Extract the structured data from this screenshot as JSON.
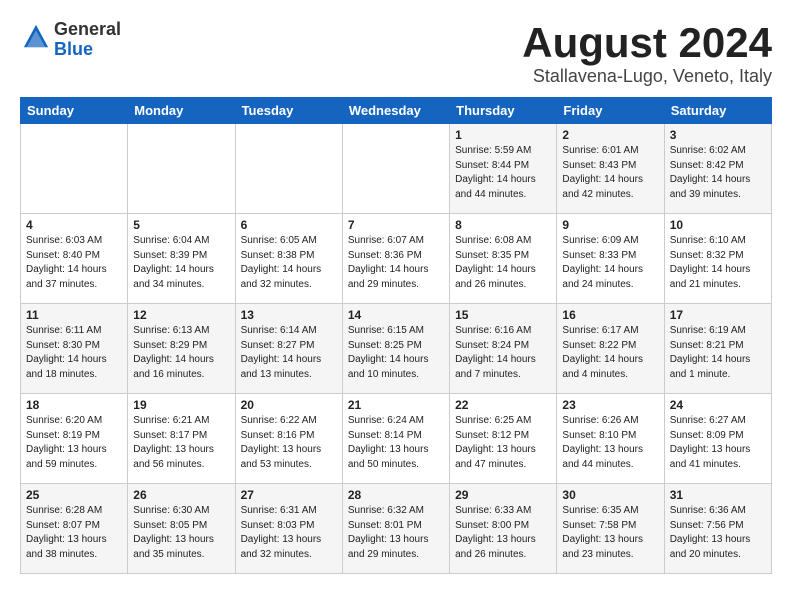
{
  "logo": {
    "general": "General",
    "blue": "Blue"
  },
  "header": {
    "month_year": "August 2024",
    "location": "Stallavena-Lugo, Veneto, Italy"
  },
  "days_of_week": [
    "Sunday",
    "Monday",
    "Tuesday",
    "Wednesday",
    "Thursday",
    "Friday",
    "Saturday"
  ],
  "weeks": [
    [
      {
        "day": "",
        "info": ""
      },
      {
        "day": "",
        "info": ""
      },
      {
        "day": "",
        "info": ""
      },
      {
        "day": "",
        "info": ""
      },
      {
        "day": "1",
        "info": "Sunrise: 5:59 AM\nSunset: 8:44 PM\nDaylight: 14 hours\nand 44 minutes."
      },
      {
        "day": "2",
        "info": "Sunrise: 6:01 AM\nSunset: 8:43 PM\nDaylight: 14 hours\nand 42 minutes."
      },
      {
        "day": "3",
        "info": "Sunrise: 6:02 AM\nSunset: 8:42 PM\nDaylight: 14 hours\nand 39 minutes."
      }
    ],
    [
      {
        "day": "4",
        "info": "Sunrise: 6:03 AM\nSunset: 8:40 PM\nDaylight: 14 hours\nand 37 minutes."
      },
      {
        "day": "5",
        "info": "Sunrise: 6:04 AM\nSunset: 8:39 PM\nDaylight: 14 hours\nand 34 minutes."
      },
      {
        "day": "6",
        "info": "Sunrise: 6:05 AM\nSunset: 8:38 PM\nDaylight: 14 hours\nand 32 minutes."
      },
      {
        "day": "7",
        "info": "Sunrise: 6:07 AM\nSunset: 8:36 PM\nDaylight: 14 hours\nand 29 minutes."
      },
      {
        "day": "8",
        "info": "Sunrise: 6:08 AM\nSunset: 8:35 PM\nDaylight: 14 hours\nand 26 minutes."
      },
      {
        "day": "9",
        "info": "Sunrise: 6:09 AM\nSunset: 8:33 PM\nDaylight: 14 hours\nand 24 minutes."
      },
      {
        "day": "10",
        "info": "Sunrise: 6:10 AM\nSunset: 8:32 PM\nDaylight: 14 hours\nand 21 minutes."
      }
    ],
    [
      {
        "day": "11",
        "info": "Sunrise: 6:11 AM\nSunset: 8:30 PM\nDaylight: 14 hours\nand 18 minutes."
      },
      {
        "day": "12",
        "info": "Sunrise: 6:13 AM\nSunset: 8:29 PM\nDaylight: 14 hours\nand 16 minutes."
      },
      {
        "day": "13",
        "info": "Sunrise: 6:14 AM\nSunset: 8:27 PM\nDaylight: 14 hours\nand 13 minutes."
      },
      {
        "day": "14",
        "info": "Sunrise: 6:15 AM\nSunset: 8:25 PM\nDaylight: 14 hours\nand 10 minutes."
      },
      {
        "day": "15",
        "info": "Sunrise: 6:16 AM\nSunset: 8:24 PM\nDaylight: 14 hours\nand 7 minutes."
      },
      {
        "day": "16",
        "info": "Sunrise: 6:17 AM\nSunset: 8:22 PM\nDaylight: 14 hours\nand 4 minutes."
      },
      {
        "day": "17",
        "info": "Sunrise: 6:19 AM\nSunset: 8:21 PM\nDaylight: 14 hours\nand 1 minute."
      }
    ],
    [
      {
        "day": "18",
        "info": "Sunrise: 6:20 AM\nSunset: 8:19 PM\nDaylight: 13 hours\nand 59 minutes."
      },
      {
        "day": "19",
        "info": "Sunrise: 6:21 AM\nSunset: 8:17 PM\nDaylight: 13 hours\nand 56 minutes."
      },
      {
        "day": "20",
        "info": "Sunrise: 6:22 AM\nSunset: 8:16 PM\nDaylight: 13 hours\nand 53 minutes."
      },
      {
        "day": "21",
        "info": "Sunrise: 6:24 AM\nSunset: 8:14 PM\nDaylight: 13 hours\nand 50 minutes."
      },
      {
        "day": "22",
        "info": "Sunrise: 6:25 AM\nSunset: 8:12 PM\nDaylight: 13 hours\nand 47 minutes."
      },
      {
        "day": "23",
        "info": "Sunrise: 6:26 AM\nSunset: 8:10 PM\nDaylight: 13 hours\nand 44 minutes."
      },
      {
        "day": "24",
        "info": "Sunrise: 6:27 AM\nSunset: 8:09 PM\nDaylight: 13 hours\nand 41 minutes."
      }
    ],
    [
      {
        "day": "25",
        "info": "Sunrise: 6:28 AM\nSunset: 8:07 PM\nDaylight: 13 hours\nand 38 minutes."
      },
      {
        "day": "26",
        "info": "Sunrise: 6:30 AM\nSunset: 8:05 PM\nDaylight: 13 hours\nand 35 minutes."
      },
      {
        "day": "27",
        "info": "Sunrise: 6:31 AM\nSunset: 8:03 PM\nDaylight: 13 hours\nand 32 minutes."
      },
      {
        "day": "28",
        "info": "Sunrise: 6:32 AM\nSunset: 8:01 PM\nDaylight: 13 hours\nand 29 minutes."
      },
      {
        "day": "29",
        "info": "Sunrise: 6:33 AM\nSunset: 8:00 PM\nDaylight: 13 hours\nand 26 minutes."
      },
      {
        "day": "30",
        "info": "Sunrise: 6:35 AM\nSunset: 7:58 PM\nDaylight: 13 hours\nand 23 minutes."
      },
      {
        "day": "31",
        "info": "Sunrise: 6:36 AM\nSunset: 7:56 PM\nDaylight: 13 hours\nand 20 minutes."
      }
    ]
  ]
}
